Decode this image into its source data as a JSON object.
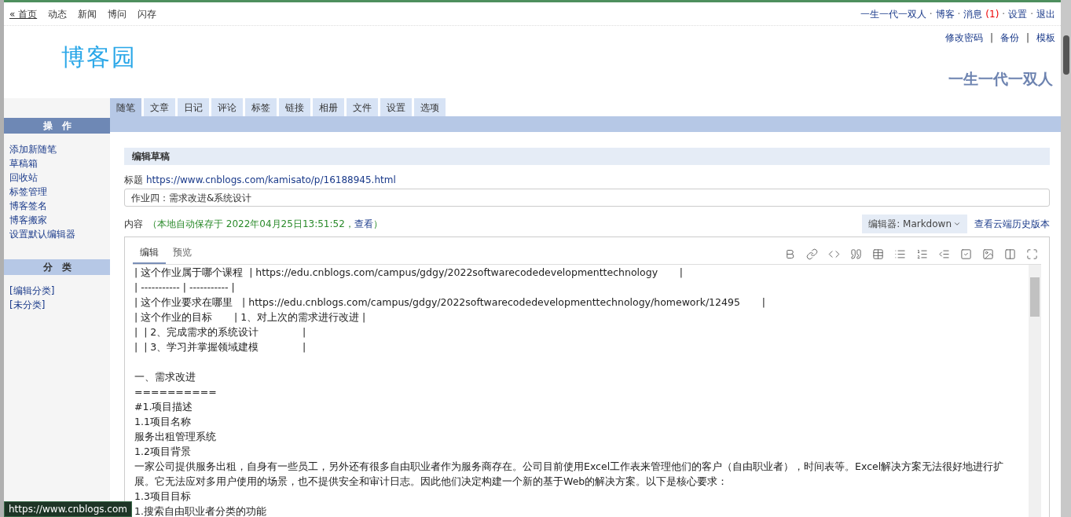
{
  "top_nav": {
    "left": [
      {
        "label": "« 首页",
        "underlined": true
      },
      {
        "label": "动态",
        "underlined": false
      },
      {
        "label": "新闻",
        "underlined": false
      },
      {
        "label": "博问",
        "underlined": false
      },
      {
        "label": "闪存",
        "underlined": false
      }
    ],
    "right": [
      {
        "label": "一生一代一双人"
      },
      {
        "label": "博客"
      },
      {
        "label": "消息",
        "count": "(1)"
      },
      {
        "label": "设置"
      },
      {
        "label": "退出"
      }
    ],
    "separator": "·"
  },
  "header": {
    "logo": "博客园",
    "links": [
      "修改密码",
      "备份",
      "模板"
    ],
    "link_separator": "|",
    "blog_title": "一生一代一双人"
  },
  "tabs": [
    {
      "label": "随笔",
      "selected": true
    },
    {
      "label": "文章",
      "selected": false
    },
    {
      "label": "日记",
      "selected": false
    },
    {
      "label": "评论",
      "selected": false
    },
    {
      "label": "标签",
      "selected": false
    },
    {
      "label": "链接",
      "selected": false
    },
    {
      "label": "相册",
      "selected": false
    },
    {
      "label": "文件",
      "selected": false
    },
    {
      "label": "设置",
      "selected": false
    },
    {
      "label": "选项",
      "selected": false
    }
  ],
  "sidebar": {
    "sections": [
      {
        "title": "操　作",
        "kind": "dark",
        "items": [
          "添加新随笔",
          "草稿箱",
          "回收站",
          "标签管理",
          "博客签名",
          "博客搬家",
          "设置默认编辑器"
        ]
      },
      {
        "title": "分　类",
        "kind": "light",
        "items": [
          "[编辑分类]",
          "[未分类]"
        ]
      }
    ]
  },
  "editor_page": {
    "heading": "编辑草稿",
    "title_label": "标题",
    "title_url": "https://www.cnblogs.com/kamisato/p/16188945.html",
    "title_value": "作业四：需求改进&系统设计",
    "content_label": "内容",
    "autosave": "（本地自动保存于 2022年04月25日13:51:52，",
    "autosave_link": "查看",
    "autosave_end": "）",
    "editor_select": "编辑器: Markdown",
    "history_link": "查看云端历史版本",
    "editor_tabs": [
      {
        "label": "编辑",
        "selected": true
      },
      {
        "label": "预览",
        "selected": false
      }
    ],
    "lines": [
      {
        "kind": "text",
        "text": "| 这个作业属于哪个课程  | https://edu.cnblogs.com/campus/gdgy/2022softwarecodedevelopmenttechnology       |"
      },
      {
        "kind": "text",
        "text": "| ----------- | ----------- |"
      },
      {
        "kind": "text",
        "text": "| 这个作业要求在哪里   | https://edu.cnblogs.com/campus/gdgy/2022softwarecodedevelopmenttechnology/homework/12495       |"
      },
      {
        "kind": "text",
        "text": "| 这个作业的目标       | 1、对上次的需求进行改进 |"
      },
      {
        "kind": "text",
        "text": "|  | 2、完成需求的系统设计              |"
      },
      {
        "kind": "text",
        "text": "|  | 3、学习并掌握领域建模              |"
      },
      {
        "kind": "blank"
      },
      {
        "kind": "text",
        "text": "一、需求改进"
      },
      {
        "kind": "text",
        "text": "=========="
      },
      {
        "kind": "text",
        "text": "#1.项目描述"
      },
      {
        "kind": "text",
        "text": "1.1项目名称"
      },
      {
        "kind": "text",
        "text": "服务出租管理系统"
      },
      {
        "kind": "text",
        "text": "1.2项目背景"
      },
      {
        "kind": "text",
        "text": "一家公司提供服务出租，自身有一些员工，另外还有很多自由职业者作为服务商存在。公司目前使用Excel工作表来管理他们的客户（自由职业者），时间表等。Excel解决方案无法很好地进行扩展。它无法应对多用户使用的场景，也不提供安全和审计日志。因此他们决定构建一个新的基于Web的解决方案。以下是核心要求："
      },
      {
        "kind": "text",
        "text": "1.3项目目标"
      },
      {
        "kind": "text",
        "text": "1.搜索自由职业者分类的功能"
      }
    ]
  },
  "status_link": "https://www.cnblogs.com"
}
